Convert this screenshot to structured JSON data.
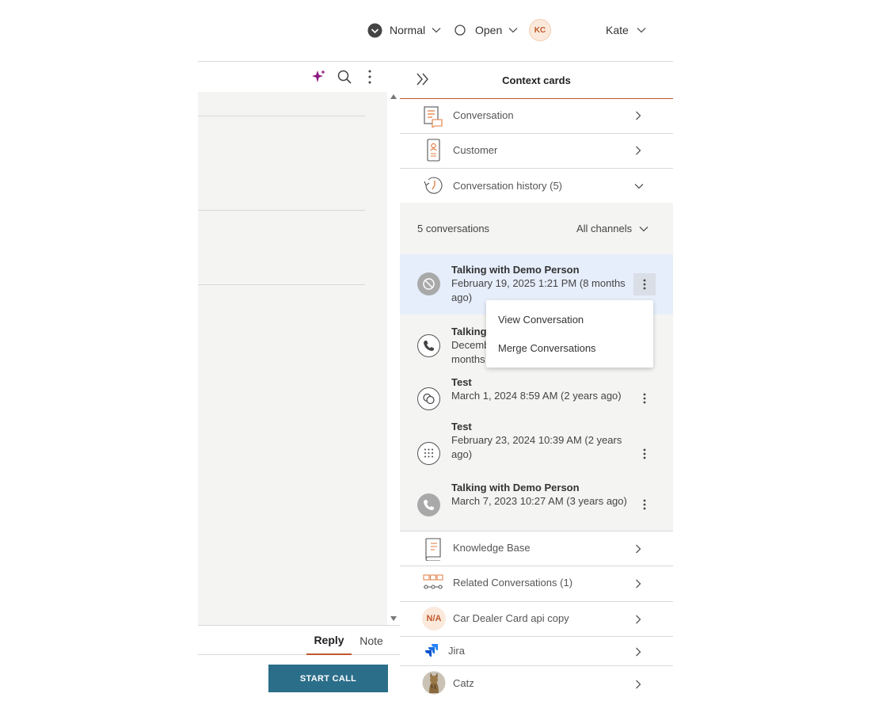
{
  "topbar": {
    "status_label": "Normal",
    "state_label": "Open",
    "avatar_initials": "KC",
    "user_name": "Kate"
  },
  "composer": {
    "tabs": [
      {
        "label": "Reply",
        "active": true
      },
      {
        "label": "Note",
        "active": false
      }
    ],
    "start_call_label": "START CALL"
  },
  "context": {
    "title": "Context cards",
    "cards_top": [
      {
        "label": "Conversation",
        "icon": "conversation-card-icon"
      },
      {
        "label": "Customer",
        "icon": "customer-card-icon"
      }
    ],
    "history": {
      "label": "Conversation history",
      "count": "(5)",
      "summary": "5 conversations",
      "filter_label": "All channels",
      "items": [
        {
          "title": "Talking with Demo Person",
          "date": "February 19, 2025 1:21 PM (8 months ago)",
          "icon": "blocked-icon"
        },
        {
          "title": "Talking",
          "date": "Decemb months",
          "icon": "phone-icon"
        },
        {
          "title": "Test",
          "date": "March 1, 2024 8:59 AM (2 years ago)",
          "icon": "chat-icon"
        },
        {
          "title": "Test",
          "date": "February 23, 2024 10:39 AM (2 years ago)",
          "icon": "keypad-icon"
        },
        {
          "title": "Talking with Demo Person",
          "date": "March 7, 2023 10:27 AM (3 years ago)",
          "icon": "phone-icon"
        }
      ],
      "menu": [
        "View Conversation",
        "Merge Conversations"
      ]
    },
    "cards_bottom": [
      {
        "label": "Knowledge Base",
        "icon": "knowledge-base-icon"
      },
      {
        "label": "Related Conversations",
        "count": "(1)",
        "icon": "related-conversations-icon"
      },
      {
        "label": "Car Dealer Card api copy",
        "badge": "N/A",
        "icon": "na-badge-icon"
      },
      {
        "label": "Jira",
        "icon": "jira-icon"
      },
      {
        "label": "Catz",
        "icon": "cat-avatar-icon"
      }
    ]
  },
  "colors": {
    "accent": "#c0582d",
    "primary_button": "#2b6e8a",
    "ai_sparkle": "#8b1a7e",
    "history_bg": "#f4f4f2",
    "selected_row": "#e6eefb"
  }
}
